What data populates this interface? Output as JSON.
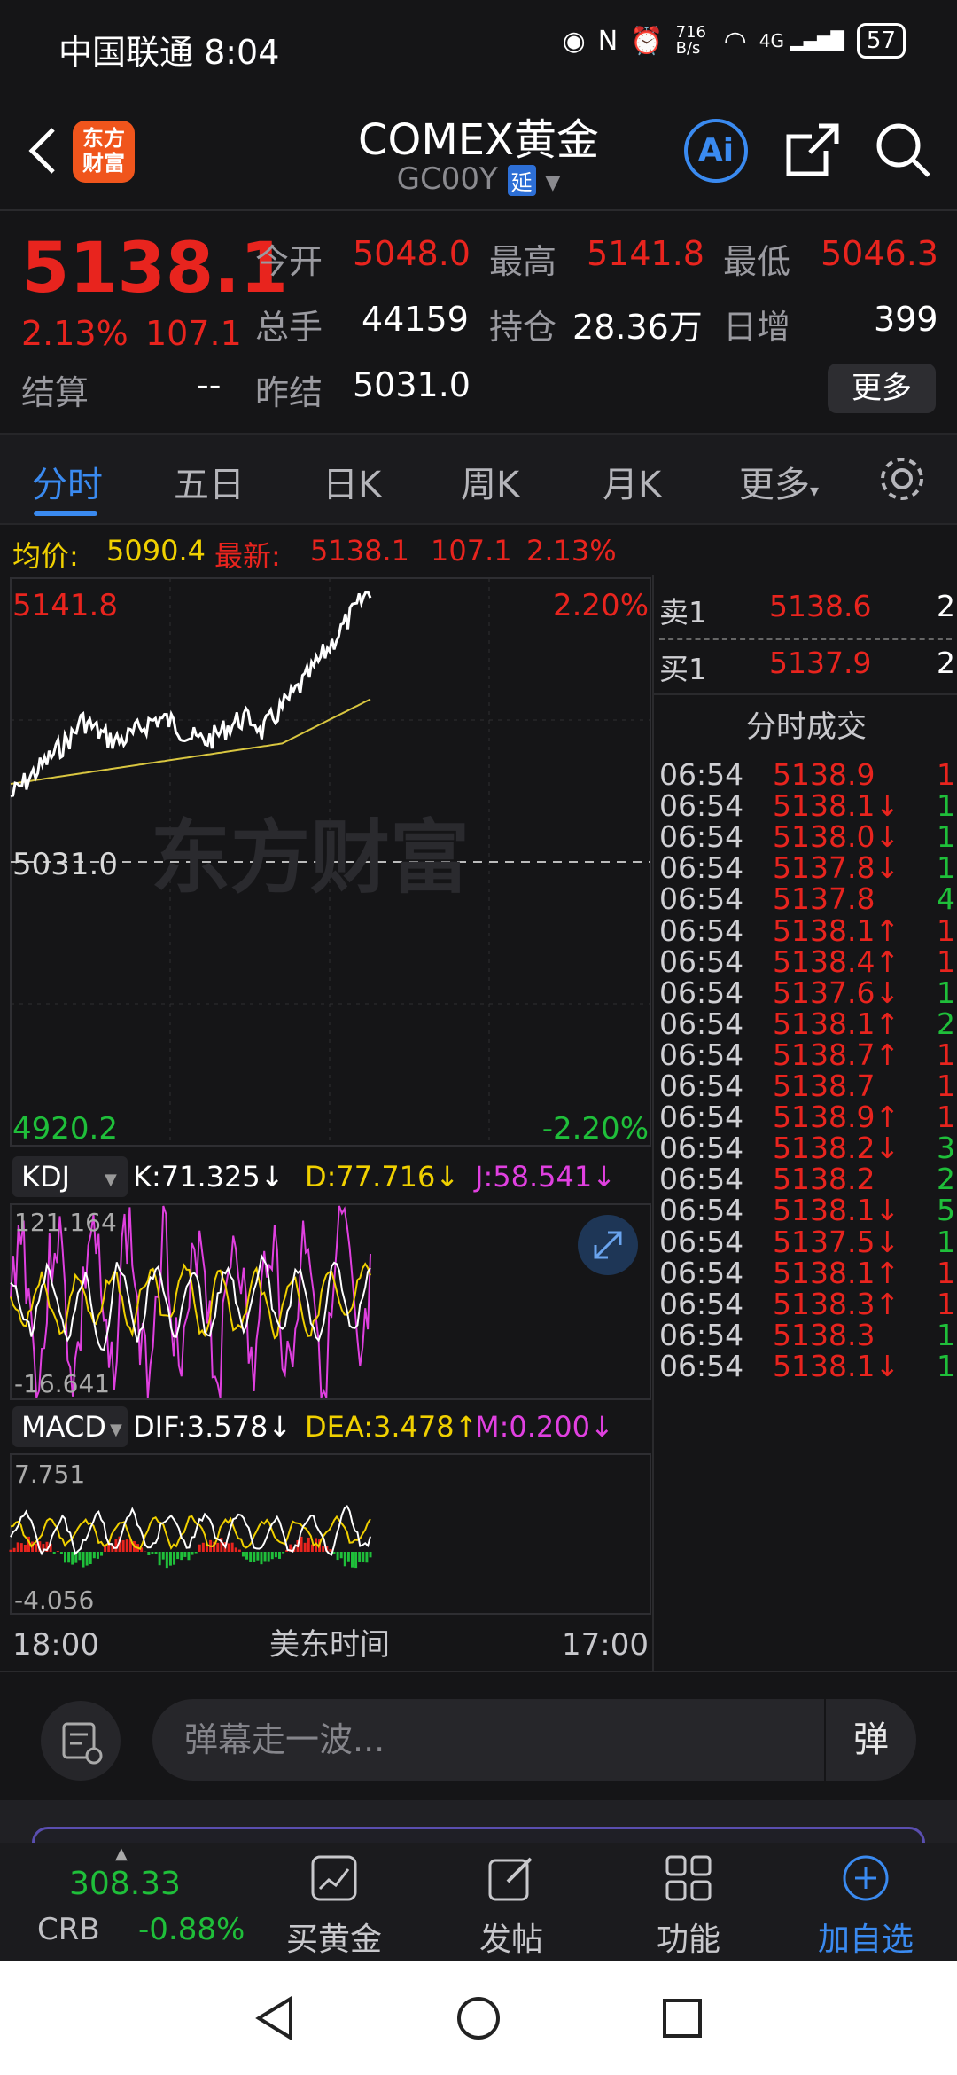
{
  "status": {
    "carrier": "中国联通 8:04",
    "speed": "716 B/s",
    "network": "4G",
    "battery": "57"
  },
  "header": {
    "title": "COMEX黄金",
    "code": "GC00Y",
    "delay_badge": "延",
    "logo": "东方财富",
    "ai_label": "Ai"
  },
  "quote": {
    "price": "5138.1",
    "change_pct": "2.13%",
    "change": "107.1",
    "open_label": "今开",
    "open": "5048.0",
    "high_label": "最高",
    "high": "5141.8",
    "low_label": "最低",
    "low": "5046.3",
    "volume_label": "总手",
    "volume": "44159",
    "oi_label": "持仓",
    "oi": "28.36万",
    "daily_inc_label": "日增",
    "daily_inc": "399",
    "settle_label": "结算",
    "settle": "--",
    "prev_settle_label": "昨结",
    "prev_settle": "5031.0",
    "more_label": "更多"
  },
  "tabs": [
    "分时",
    "五日",
    "日K",
    "周K",
    "月K",
    "更多"
  ],
  "avgline": {
    "avg_label": "均价:",
    "avg": "5090.4",
    "latest_label": "最新:",
    "latest": "5138.1",
    "change": "107.1",
    "pct": "2.13%"
  },
  "chart": {
    "top_price": "5141.8",
    "top_pct": "2.20%",
    "mid_price": "5031.0",
    "bottom_price": "4920.2",
    "bottom_pct": "-2.20%",
    "watermark": "东方财富",
    "x_start": "18:00",
    "x_mid": "美东时间",
    "x_end": "17:00",
    "kdj_label": "KDJ",
    "kdj_k": "K:71.325↓",
    "kdj_d": "D:77.716↓",
    "kdj_j": "J:58.541↓",
    "kdj_max": "121.164",
    "kdj_min": "-16.641",
    "macd_label": "MACD",
    "dif": "DIF:3.578↓",
    "dea": "DEA:3.478↑",
    "m": "M:0.200↓",
    "macd_max": "7.751",
    "macd_min": "-4.056",
    "colors": {
      "price": "#ffffff",
      "avg": "#d9c640",
      "up": "#e8241e",
      "down": "#1fbf3a"
    }
  },
  "orderbook": {
    "sell_label": "卖1",
    "sell_price": "5138.6",
    "sell_vol": "2",
    "buy_label": "买1",
    "buy_price": "5137.9",
    "buy_vol": "2",
    "ticks_title": "分时成交"
  },
  "ticks": [
    {
      "t": "06:54",
      "p": "5138.9",
      "v": "1",
      "c": "red",
      "vc": "red"
    },
    {
      "t": "06:54",
      "p": "5138.1↓",
      "v": "1",
      "c": "red",
      "vc": "green"
    },
    {
      "t": "06:54",
      "p": "5138.0↓",
      "v": "1",
      "c": "red",
      "vc": "green"
    },
    {
      "t": "06:54",
      "p": "5137.8↓",
      "v": "1",
      "c": "red",
      "vc": "green"
    },
    {
      "t": "06:54",
      "p": "5137.8",
      "v": "4",
      "c": "red",
      "vc": "green"
    },
    {
      "t": "06:54",
      "p": "5138.1↑",
      "v": "1",
      "c": "red",
      "vc": "red"
    },
    {
      "t": "06:54",
      "p": "5138.4↑",
      "v": "1",
      "c": "red",
      "vc": "red"
    },
    {
      "t": "06:54",
      "p": "5137.6↓",
      "v": "1",
      "c": "red",
      "vc": "green"
    },
    {
      "t": "06:54",
      "p": "5138.1↑",
      "v": "2",
      "c": "red",
      "vc": "green"
    },
    {
      "t": "06:54",
      "p": "5138.7↑",
      "v": "1",
      "c": "red",
      "vc": "red"
    },
    {
      "t": "06:54",
      "p": "5138.7",
      "v": "1",
      "c": "red",
      "vc": "red"
    },
    {
      "t": "06:54",
      "p": "5138.9↑",
      "v": "1",
      "c": "red",
      "vc": "red"
    },
    {
      "t": "06:54",
      "p": "5138.2↓",
      "v": "3",
      "c": "red",
      "vc": "green"
    },
    {
      "t": "06:54",
      "p": "5138.2",
      "v": "2",
      "c": "red",
      "vc": "green"
    },
    {
      "t": "06:54",
      "p": "5138.1↓",
      "v": "5",
      "c": "red",
      "vc": "green"
    },
    {
      "t": "06:54",
      "p": "5137.5↓",
      "v": "1",
      "c": "red",
      "vc": "green"
    },
    {
      "t": "06:54",
      "p": "5138.1↑",
      "v": "1",
      "c": "red",
      "vc": "red"
    },
    {
      "t": "06:54",
      "p": "5138.3↑",
      "v": "1",
      "c": "red",
      "vc": "red"
    },
    {
      "t": "06:54",
      "p": "5138.3",
      "v": "1",
      "c": "red",
      "vc": "green"
    },
    {
      "t": "06:54",
      "p": "5138.1↓",
      "v": "1",
      "c": "red",
      "vc": "green"
    }
  ],
  "chat": {
    "placeholder": "弹幕走一波...",
    "danmu": "弹"
  },
  "bottomnav": {
    "crb_value": "308.33",
    "crb_name": "CRB",
    "crb_change": "-0.88%",
    "buy_gold": "买黄金",
    "post": "发帖",
    "func": "功能",
    "add": "加自选"
  }
}
